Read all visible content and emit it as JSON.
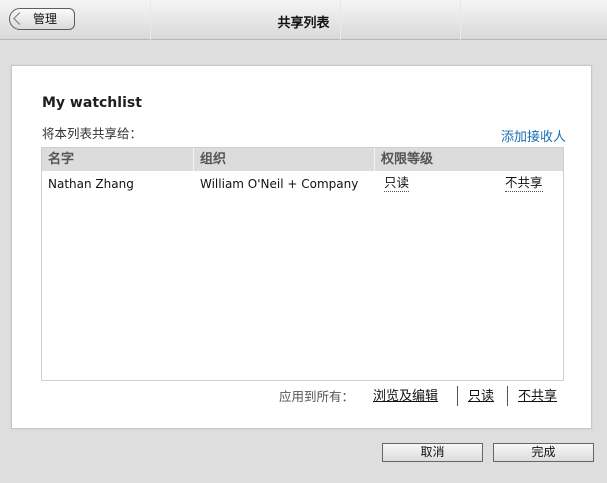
{
  "header": {
    "back_label": "管理",
    "title": "共享列表"
  },
  "card": {
    "watchlist_name": "My watchlist",
    "share_label": "将本列表共享给：",
    "add_recipient_label": "添加接收人"
  },
  "table": {
    "columns": [
      "名字",
      "组织",
      "权限等级"
    ],
    "rows": [
      {
        "name": "Nathan Zhang",
        "organization": "William O'Neil + Company",
        "permission": "只读",
        "unshare": "不共享"
      }
    ]
  },
  "apply_all": {
    "label": "应用到所有：",
    "options": [
      "浏览及编辑",
      "只读",
      "不共享"
    ]
  },
  "footer": {
    "cancel_label": "取消",
    "done_label": "完成"
  },
  "colors": {
    "link": "#1a6fb5",
    "header_bg": "#dcdcdc",
    "page_bg": "#dedede"
  }
}
